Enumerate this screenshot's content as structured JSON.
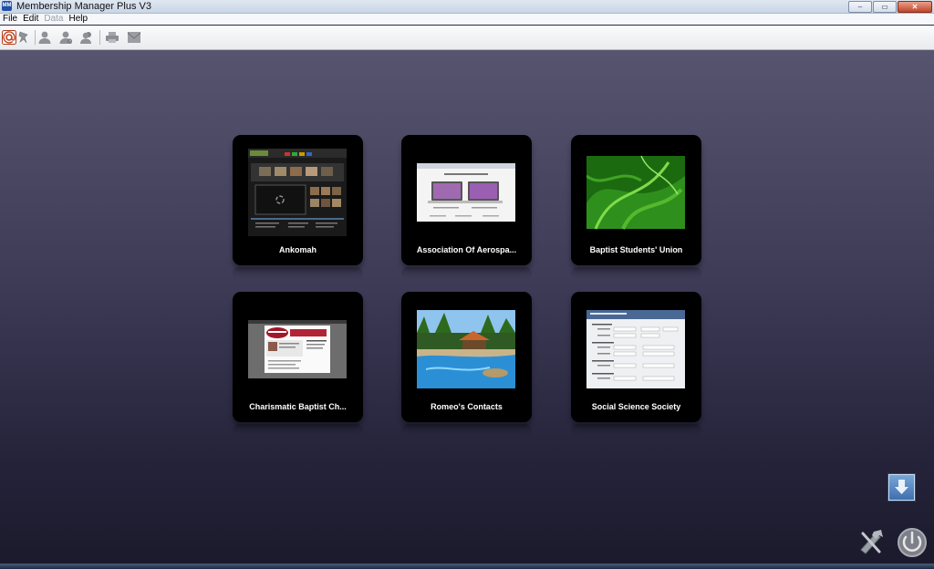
{
  "window": {
    "title": "Membership Manager Plus V3",
    "icon": "app-icon",
    "icon_text": "MM",
    "controls": {
      "minimize": "–",
      "maximize": "▭",
      "close": "✕"
    }
  },
  "menubar": {
    "items": [
      {
        "label": "File",
        "enabled": true
      },
      {
        "label": "Edit",
        "enabled": true
      },
      {
        "label": "Data",
        "enabled": false
      },
      {
        "label": "Help",
        "enabled": true
      }
    ]
  },
  "toolbar": {
    "icons": [
      "at-sign-icon",
      "pin-icon",
      "user-icon",
      "user-search-icon",
      "users-icon",
      "print-icon",
      "mail-icon"
    ]
  },
  "databases": [
    {
      "name": "Ankomah",
      "thumbnail": "website-screenshot"
    },
    {
      "name": "Association Of Aerospa...",
      "thumbnail": "laptops-webpage"
    },
    {
      "name": "Baptist Students' Union",
      "thumbnail": "green-swirl"
    },
    {
      "name": "Charismatic Baptist Ch...",
      "thumbnail": "church-website"
    },
    {
      "name": "Romeo's Contacts",
      "thumbnail": "resort-pool"
    },
    {
      "name": "Social Science Society",
      "thumbnail": "form-screenshot"
    }
  ],
  "corner_controls": {
    "scroll_down": "down-arrow-icon",
    "settings": "tools-icon",
    "power": "power-icon"
  },
  "colors": {
    "background_top": "#57546f",
    "background_bottom": "#1b1a2c",
    "tile": "#000000",
    "label": "#ffffff"
  }
}
